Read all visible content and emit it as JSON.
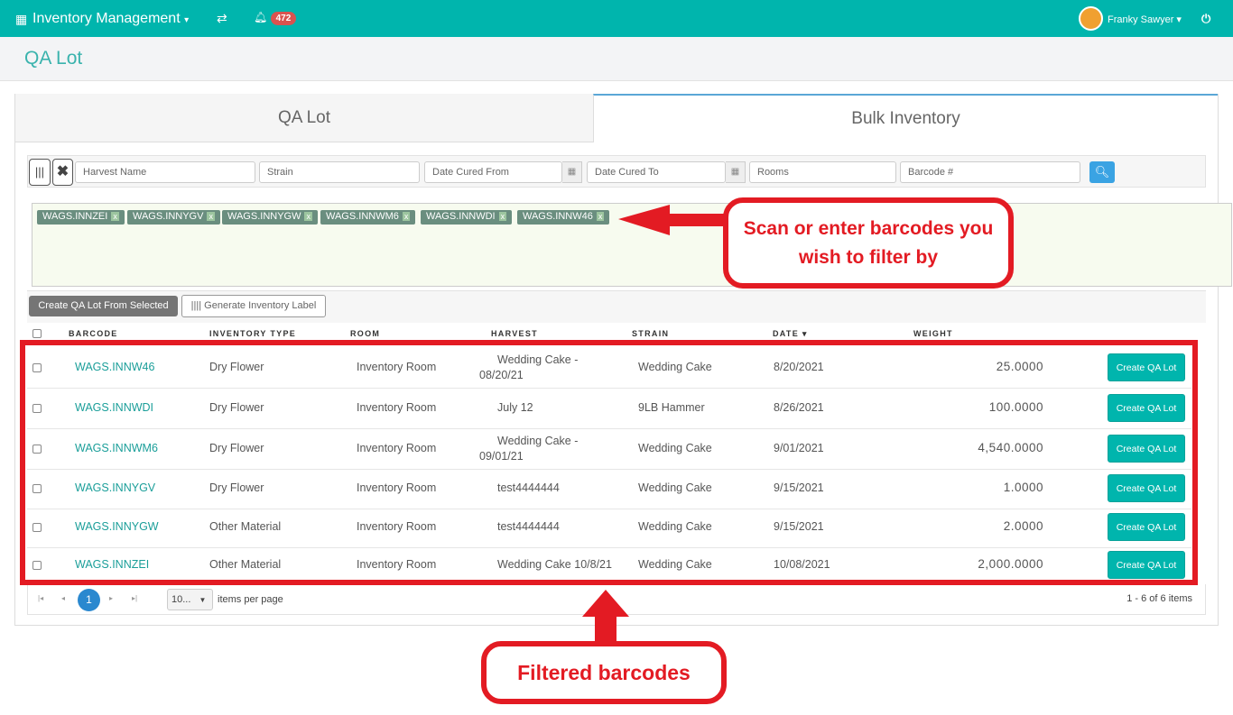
{
  "topbar": {
    "title": "Inventory Management",
    "notifications": "472",
    "user": "Franky Sawyer"
  },
  "page_title": "QA Lot",
  "tabs": [
    {
      "label": "QA Lot"
    },
    {
      "label": "Bulk Inventory"
    }
  ],
  "filters": {
    "harvest_placeholder": "Harvest Name",
    "strain_placeholder": "Strain",
    "date_from_placeholder": "Date Cured From",
    "date_to_placeholder": "Date Cured To",
    "rooms_placeholder": "Rooms",
    "barcode_placeholder": "Barcode #"
  },
  "tags": [
    "WAGS.INNZEI",
    "WAGS.INNYGV",
    "WAGS.INNYGW",
    "WAGS.INNWM6",
    "WAGS.INNWDI",
    "WAGS.INNW46"
  ],
  "tag_remove": "x",
  "actions": {
    "create_from_selected": "Create QA Lot From Selected",
    "generate_label": "Generate Inventory Label"
  },
  "columns": [
    "BARCODE",
    "INVENTORY TYPE",
    "ROOM",
    "HARVEST",
    "STRAIN",
    "DATE ▾",
    "WEIGHT"
  ],
  "rows": [
    {
      "barcode": "WAGS.INNW46",
      "type": "Dry Flower",
      "room": "Inventory Room",
      "harvest": "Wedding Cake - 08/20/21",
      "strain": "Wedding Cake",
      "date": "8/20/2021",
      "weight": "25.0000",
      "action": "Create QA Lot"
    },
    {
      "barcode": "WAGS.INNWDI",
      "type": "Dry Flower",
      "room": "Inventory Room",
      "harvest": "July 12",
      "strain": "9LB Hammer",
      "date": "8/26/2021",
      "weight": "100.0000",
      "action": "Create QA Lot"
    },
    {
      "barcode": "WAGS.INNWM6",
      "type": "Dry Flower",
      "room": "Inventory Room",
      "harvest": "Wedding Cake - 09/01/21",
      "strain": "Wedding Cake",
      "date": "9/01/2021",
      "weight": "4,540.0000",
      "action": "Create QA Lot"
    },
    {
      "barcode": "WAGS.INNYGV",
      "type": "Dry Flower",
      "room": "Inventory Room",
      "harvest": "test4444444",
      "strain": "Wedding Cake",
      "date": "9/15/2021",
      "weight": "1.0000",
      "action": "Create QA Lot"
    },
    {
      "barcode": "WAGS.INNYGW",
      "type": "Other Material",
      "room": "Inventory Room",
      "harvest": "test4444444",
      "strain": "Wedding Cake",
      "date": "9/15/2021",
      "weight": "2.0000",
      "action": "Create QA Lot"
    },
    {
      "barcode": "WAGS.INNZEI",
      "type": "Other Material",
      "room": "Inventory Room",
      "harvest": "Wedding Cake 10/8/21",
      "strain": "Wedding Cake",
      "date": "10/08/2021",
      "weight": "2,000.0000",
      "action": "Create QA Lot"
    }
  ],
  "pager": {
    "page": "1",
    "page_size": "10...",
    "per_page_label": "items per page",
    "summary": "1 - 6 of 6 items"
  },
  "annotations": {
    "filter_callout": "Scan or enter barcodes you wish to filter by",
    "results_callout": "Filtered barcodes"
  }
}
